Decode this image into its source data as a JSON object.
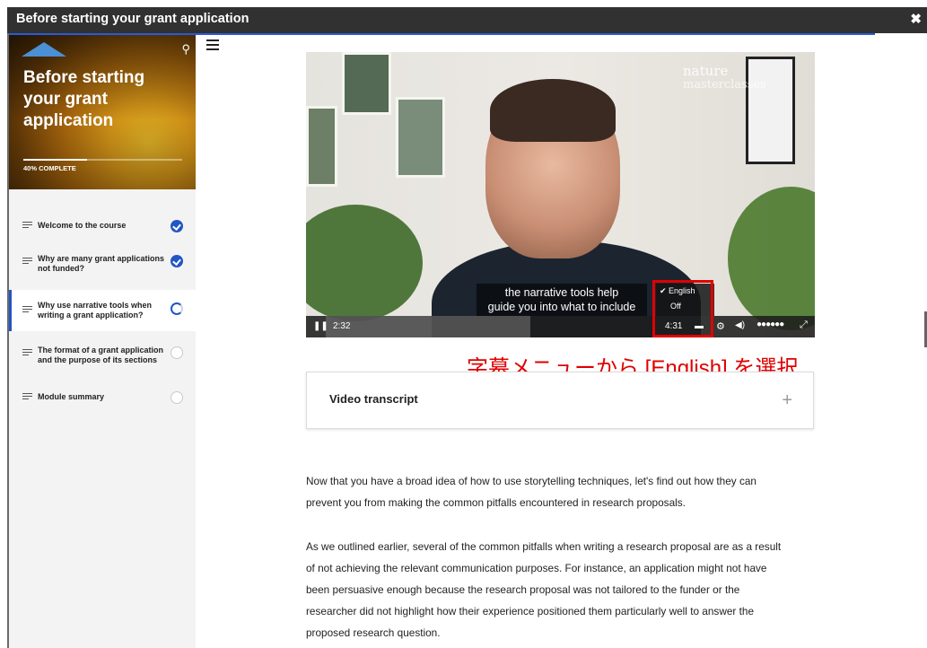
{
  "window": {
    "title": "Before starting your grant application",
    "close_label": "✖"
  },
  "sidebar": {
    "hero_title": "Before starting your grant application",
    "progress_label": "40% COMPLETE",
    "progress_fraction": 0.4,
    "search_icon": "search-icon",
    "items": [
      {
        "label": "Welcome to the course",
        "status": "complete"
      },
      {
        "label": "Why are many grant applications not funded?",
        "status": "complete"
      },
      {
        "label": "Why use narrative tools when writing a grant application?",
        "status": "in-progress"
      },
      {
        "label": "The format of a grant application and the purpose of its sections",
        "status": "not-started"
      },
      {
        "label": "Module summary",
        "status": "not-started"
      }
    ]
  },
  "video": {
    "brand_line1": "nature",
    "brand_line2": "masterclasses",
    "subtitle_line1": "the narrative tools help",
    "subtitle_line2": "guide you into what to include",
    "current_time": "2:32",
    "duration": "4:31",
    "caption_options": [
      "English",
      "Off"
    ],
    "selected_caption": "English"
  },
  "annotation": "字幕メニューから [English] を選択",
  "transcript": {
    "label": "Video transcript",
    "expand_icon": "+"
  },
  "body_text": {
    "p1_l1": "Now that you have a broad idea of how to use storytelling techniques, let's find out how they can",
    "p1_l2": "prevent you from making the common pitfalls encountered in research proposals.",
    "p2_l1": "As we outlined earlier, several of the common pitfalls when writing a research proposal are as a result",
    "p2_l2": "of not achieving the relevant communication purposes. For instance, an application might not have",
    "p2_l3": "been persuasive enough because the research proposal was not tailored to the funder or the",
    "p2_l4": "researcher did not highlight how their experience positioned them particularly well to answer the",
    "p2_l5": "proposed research question."
  }
}
